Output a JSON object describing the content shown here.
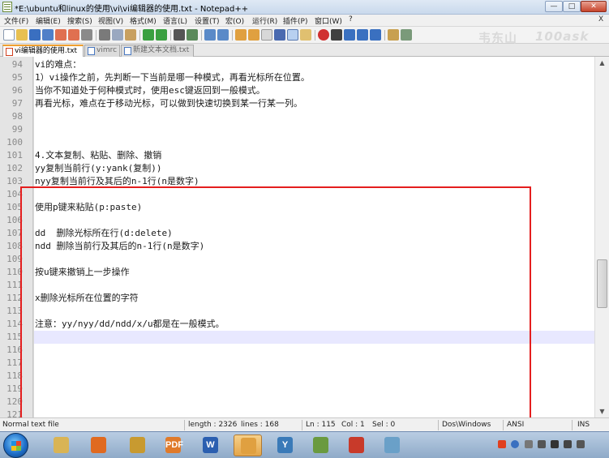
{
  "window": {
    "title": "*E:\\ubuntu和linux的使用\\vi\\vi编辑器的使用.txt - Notepad++",
    "controls": [
      "minimize",
      "maximize",
      "close"
    ]
  },
  "menu": {
    "items": [
      "文件(F)",
      "编辑(E)",
      "搜索(S)",
      "视图(V)",
      "格式(M)",
      "语言(L)",
      "设置(T)",
      "宏(O)",
      "运行(R)",
      "插件(P)",
      "窗口(W)",
      "?"
    ],
    "right_label": "X"
  },
  "toolbar": {
    "watermark": "韦东山",
    "watermark_logo": "100ask"
  },
  "tabs": [
    {
      "label": "vi编辑器的使用.txt",
      "active": true
    },
    {
      "label": "vimrc",
      "active": false
    },
    {
      "label": "新建文本文档.txt",
      "active": false
    }
  ],
  "editor": {
    "lines": [
      {
        "num": "94",
        "text": "vi的难点："
      },
      {
        "num": "95",
        "text": "1）vi操作之前，先判断一下当前是哪一种模式，再看光标所在位置。"
      },
      {
        "num": "96",
        "text": "当你不知道处于何种模式时，使用esc键返回到一般模式。"
      },
      {
        "num": "97",
        "text": "再看光标，难点在于移动光标，可以做到快速切换到某一行某一列。"
      },
      {
        "num": "98",
        "text": ""
      },
      {
        "num": "99",
        "text": ""
      },
      {
        "num": "100",
        "text": ""
      },
      {
        "num": "101",
        "text": "4.文本复制、粘贴、删除、撤销"
      },
      {
        "num": "102",
        "text": "yy复制当前行(y:yank(复制))"
      },
      {
        "num": "103",
        "text": "nyy复制当前行及其后的n-1行(n是数字)"
      },
      {
        "num": "104",
        "text": ""
      },
      {
        "num": "105",
        "text": "使用p键来粘贴(p:paste)"
      },
      {
        "num": "106",
        "text": ""
      },
      {
        "num": "107",
        "text": "dd  删除光标所在行(d:delete)"
      },
      {
        "num": "108",
        "text": "ndd 删除当前行及其后的n-1行(n是数字)"
      },
      {
        "num": "109",
        "text": ""
      },
      {
        "num": "110",
        "text": "按u键来撤销上一步操作"
      },
      {
        "num": "111",
        "text": ""
      },
      {
        "num": "112",
        "text": "x删除光标所在位置的字符"
      },
      {
        "num": "113",
        "text": ""
      },
      {
        "num": "114",
        "text": "注意：yy/nyy/dd/ndd/x/u都是在一般模式。"
      },
      {
        "num": "115",
        "text": ""
      },
      {
        "num": "116",
        "text": ""
      },
      {
        "num": "117",
        "text": ""
      },
      {
        "num": "118",
        "text": ""
      },
      {
        "num": "119",
        "text": ""
      },
      {
        "num": "120",
        "text": ""
      },
      {
        "num": "121",
        "text": ""
      },
      {
        "num": "122",
        "text": ""
      }
    ],
    "current_line": "115",
    "highlight_color": "#e41e1e"
  },
  "status": {
    "file_type": "Normal text file",
    "length": "length : 2326",
    "lines": "lines : 168",
    "ln": "Ln : 115",
    "col": "Col : 1",
    "sel": "Sel : 0",
    "eol": "Dos\\Windows",
    "encoding": "ANSI",
    "mode": "INS"
  },
  "taskbar": {
    "apps": [
      {
        "name": "explorer",
        "color": "#d9b455",
        "glyph": ""
      },
      {
        "name": "firefox",
        "color": "#e06a20",
        "glyph": ""
      },
      {
        "name": "app3",
        "color": "#c89a30",
        "glyph": ""
      },
      {
        "name": "pdf",
        "color": "#e07a2a",
        "glyph": "PDF"
      },
      {
        "name": "word",
        "color": "#2b5fb0",
        "glyph": "W"
      },
      {
        "name": "notepadpp",
        "color": "#e0a040",
        "glyph": ""
      },
      {
        "name": "app7",
        "color": "#3a7ab8",
        "glyph": "Y"
      },
      {
        "name": "app8",
        "color": "#6a9a40",
        "glyph": ""
      },
      {
        "name": "app9",
        "color": "#c83a2a",
        "glyph": ""
      },
      {
        "name": "app10",
        "color": "#6aa0c8",
        "glyph": ""
      }
    ]
  }
}
